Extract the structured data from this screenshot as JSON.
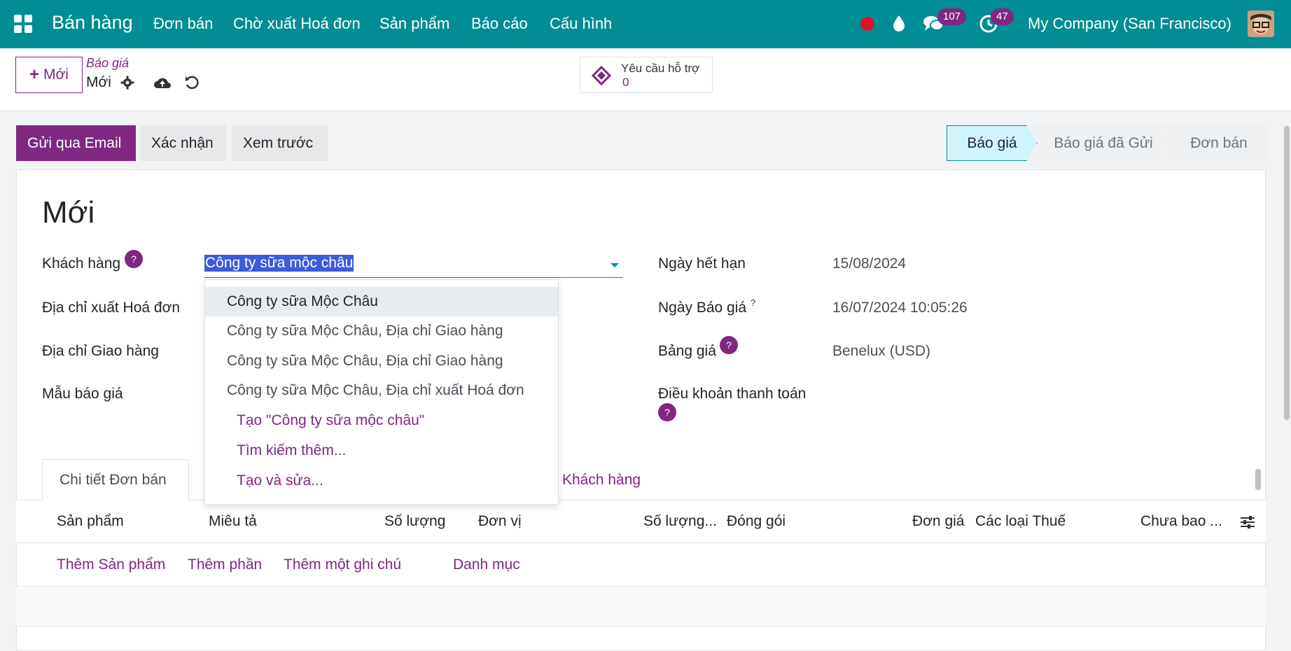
{
  "nav": {
    "app_name": "Bán hàng",
    "menu": [
      "Đơn bán",
      "Chờ xuất Hoá đơn",
      "Sản phẩm",
      "Báo cáo",
      "Cấu hình"
    ],
    "messages_count": "107",
    "activities_count": "47",
    "company": "My Company (San Francisco)"
  },
  "control": {
    "new_label": "Mới",
    "breadcrumb_parent": "Báo giá",
    "breadcrumb_current": "Mới",
    "support_label": "Yêu cầu hỗ trợ",
    "support_count": "0"
  },
  "actions": {
    "send_email": "Gửi qua Email",
    "confirm": "Xác nhận",
    "preview": "Xem trước"
  },
  "statusbar": {
    "stages": [
      "Báo giá",
      "Báo giá đã Gửi",
      "Đơn bán"
    ],
    "active_stage": "Báo giá"
  },
  "form": {
    "title": "Mới",
    "labels": {
      "customer": "Khách hàng",
      "invoice_address": "Địa chỉ xuất Hoá đơn",
      "delivery_address": "Địa chỉ Giao hàng",
      "quote_template": "Mẫu báo giá",
      "expiration": "Ngày hết hạn",
      "quote_date": "Ngày Báo giá",
      "pricelist": "Bảng giá",
      "payment_terms": "Điều khoản thanh toán"
    },
    "values": {
      "customer": "Công ty sữa mộc châu",
      "expiration": "15/08/2024",
      "quote_date": "16/07/2024 10:05:26",
      "pricelist": "Benelux (USD)"
    },
    "help_mark": "?",
    "quote_date_sup": "?"
  },
  "dropdown": {
    "items": [
      "Công ty sữa Mộc Châu",
      "Công ty sữa Mộc Châu, Địa chỉ Giao hàng",
      "Công ty sữa Mộc Châu, Địa chỉ Giao hàng",
      "Công ty sữa Mộc Châu, Địa chỉ xuất Hoá đơn"
    ],
    "actions": [
      "Tạo \"Công ty sữa mộc châu\"",
      "Tìm kiếm thêm...",
      "Tạo và sửa..."
    ]
  },
  "tabs": {
    "order_lines": "Chi tiết Đơn bán",
    "customer": "Khách hàng"
  },
  "table": {
    "headers": [
      "Sản phẩm",
      "Miêu tả",
      "Số lượng",
      "Đơn vị",
      "Số lượng...",
      "Đóng gói",
      "Đơn giá",
      "Các loại Thuế",
      "Chưa bao ..."
    ],
    "add_links": [
      "Thêm Sản phẩm",
      "Thêm phần",
      "Thêm một ghi chú",
      "Danh mục"
    ]
  },
  "colors": {
    "navbar": "#018d95",
    "primary": "#7f2781",
    "active_stage": "#cff4fc"
  },
  "icons": [
    "apps-grid-icon",
    "record-icon",
    "droplet-icon",
    "chat-icon",
    "clock-icon",
    "gear-icon",
    "cloud-upload-icon",
    "undo-icon",
    "ticket-icon",
    "caret-down-icon",
    "column-settings-icon"
  ]
}
